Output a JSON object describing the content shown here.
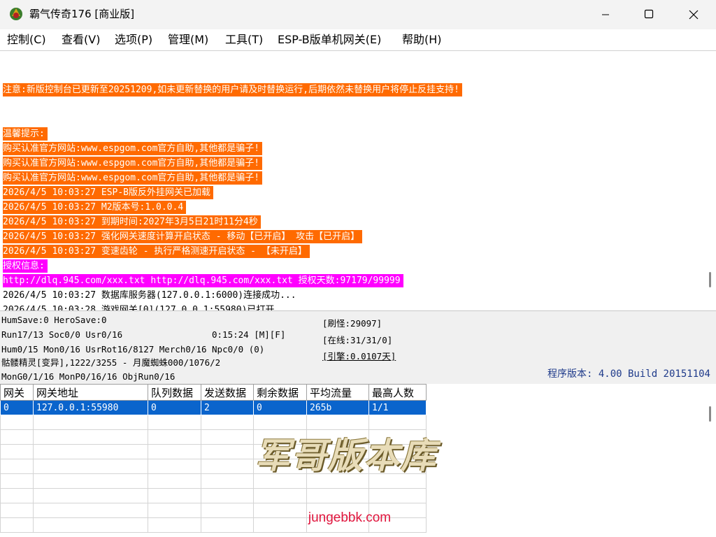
{
  "window": {
    "title": "霸气传奇176 [商业版]",
    "icon": "game-app-icon",
    "controls": [
      "minimize-icon",
      "maximize-icon",
      "close-icon"
    ]
  },
  "menu": [
    "控制(C)",
    "查看(V)",
    "选项(P)",
    "管理(M)",
    "工具(T)",
    "ESP-B版单机网关(E)",
    "帮助(H)"
  ],
  "log": {
    "notice": "注意:新版控制台已更新至20251209,如未更新替换的用户请及时替换运行,后期依然未替换用户将停止反挂支持!",
    "tips_header": "温馨提示:",
    "buy1": "购买认准官方网站:www.espgom.com官方自助,其他都是骗子!",
    "buy2": "购买认准官方网站:www.espgom.com官方自助,其他都是骗子!",
    "buy3": "购买认准官方网站:www.espgom.com官方自助,其他都是骗子!",
    "l1": "2026/4/5 10:03:27 ESP-B版反外挂网关已加载",
    "l2": "2026/4/5 10:03:27 M2版本号:1.0.0.4",
    "l3": "2026/4/5 10:03:27 到期时间:2027年3月5日21时11分4秒",
    "l4": "2026/4/5 10:03:27 强化网关速度计算开启状态 - 移动【已开启】 攻击【已开启】",
    "l5": "2026/4/5 10:03:27 变速齿轮 - 执行严格测速开启状态 - 【未开启】",
    "auth_header": "授权信息:",
    "auth": "http://dlq.945.com/xxx.txt http://dlq.945.com/xxx.txt 授权天数:97179/99999",
    "l6": "2026/4/5 10:03:27 数据库服务器(127.0.0.1:6000)连接成功...",
    "l7": "2026/4/5 10:03:28 游戏网关[0](127.0.0.1:55980)已打开..."
  },
  "status": {
    "save": "HumSave:0 HeroSave:0",
    "run": "Run17/13 Soc0/0 Usr0/16",
    "time": "0:15:24 [M][F]",
    "hum": "Hum0/15 Mon0/16 UsrRot16/8127 Merch0/16 Npc0/0 (0)",
    "monster": "骷髅精灵[变异],1222/3255 - 月魔蜘蛛000/1076/2",
    "mong": "MonG0/1/16 MonP0/16/16 ObjRun0/16",
    "refresh": "[刷怪:29097]",
    "online": "[在线:31/31/0]",
    "engine": "[引擎:0.0107天]",
    "version": "程序版本: 4.00 Build 20151104"
  },
  "table": {
    "columns": [
      "网关",
      "网关地址",
      "队列数据",
      "发送数据",
      "剩余数据",
      "平均流量",
      "最高人数"
    ],
    "rows": [
      [
        "0",
        "127.0.0.1:55980",
        "0",
        "2",
        "0",
        "265b",
        "1/1"
      ]
    ]
  },
  "watermark": {
    "logo": "军哥版本库",
    "url": "jungebbk.com"
  },
  "colors": {
    "highlight_orange": "#ff6a00",
    "highlight_magenta": "#ff00ff",
    "selection_blue": "#0a64cc",
    "version_text": "#1e3a8a"
  }
}
